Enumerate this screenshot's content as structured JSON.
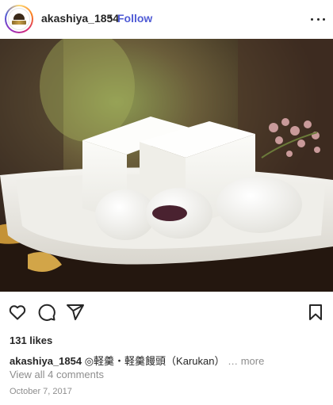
{
  "post": {
    "username": "akashiya_1854",
    "separator": "•",
    "follow_label": "Follow",
    "likes": "131 likes",
    "caption_user": "akashiya_1854",
    "caption_text": " ◎軽羹・軽羹饅頭（Karukan）",
    "caption_more": "… more",
    "comments_link": "View all 4 comments",
    "date": "October 7, 2017"
  },
  "icons": {
    "more": "more-options-icon",
    "like": "heart-icon",
    "comment": "comment-bubble-icon",
    "share": "send-paper-plane-icon",
    "save": "bookmark-icon"
  },
  "colors": {
    "link_blue": "#4f5bd5",
    "text": "#262626",
    "secondary": "#8e8e8e"
  }
}
